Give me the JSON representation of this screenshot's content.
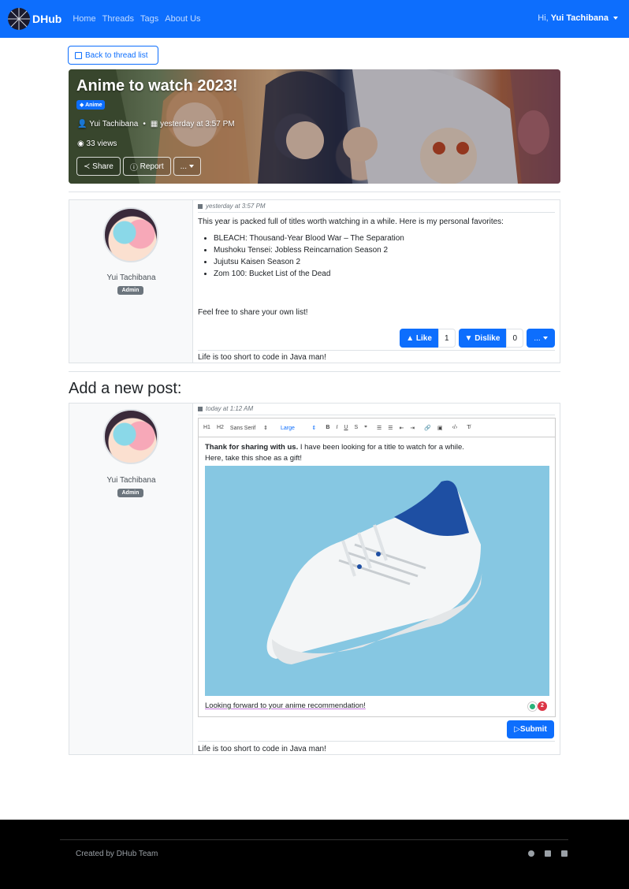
{
  "navbar": {
    "brand": "DHub",
    "links": [
      "Home",
      "Threads",
      "Tags",
      "About Us"
    ],
    "greeting": "Hi,",
    "username": "Yui Tachibana"
  },
  "back_button": "Back to thread list",
  "thread": {
    "title": "Anime to watch 2023!",
    "tag": "Anime",
    "author": "Yui Tachibana",
    "date": "yesterday at 3:57 PM",
    "views": "33 views",
    "share": "Share",
    "report": "Report",
    "more": "..."
  },
  "post": {
    "timestamp": "yesterday at 3:57 PM",
    "username": "Yui Tachibana",
    "role": "Admin",
    "intro": "This year is packed full of titles worth watching in a while. Here is my personal favorites:",
    "items": [
      "BLEACH: Thousand-Year Blood War – The Separation",
      "Mushoku Tensei: Jobless Reincarnation Season 2",
      "Jujutsu Kaisen Season 2",
      "Zom 100: Bucket List of the Dead"
    ],
    "closing": "Feel free to share your own list!",
    "like_label": "Like",
    "like_count": "1",
    "dislike_label": "Dislike",
    "dislike_count": "0",
    "signature": "Life is too short to code in Java man!"
  },
  "new_post": {
    "heading": "Add a new post:",
    "timestamp": "today at 1:12 AM",
    "username": "Yui Tachibana",
    "role": "Admin",
    "toolbar": {
      "h1": "H1",
      "h2": "H2",
      "font": "Sans Serif",
      "size": "Large"
    },
    "line1_bold_a": "Thank for sharing with us.",
    "line1_rest": " I have been looking for a title to watch for a while.",
    "line2": "Here, take this shoe as a gift!",
    "line3": "Looking forward to your anime recommendation!",
    "counter": "2",
    "submit": "Submit",
    "signature": "Life is too short to code in Java man!"
  },
  "footer": {
    "credit": "Created by DHub Team",
    "icons": [
      "github-icon",
      "facebook-icon",
      "linkedin-icon"
    ]
  },
  "colors": {
    "primary": "#0d6efd",
    "footer_bg": "#000000",
    "admin_badge": "#6c757d"
  }
}
